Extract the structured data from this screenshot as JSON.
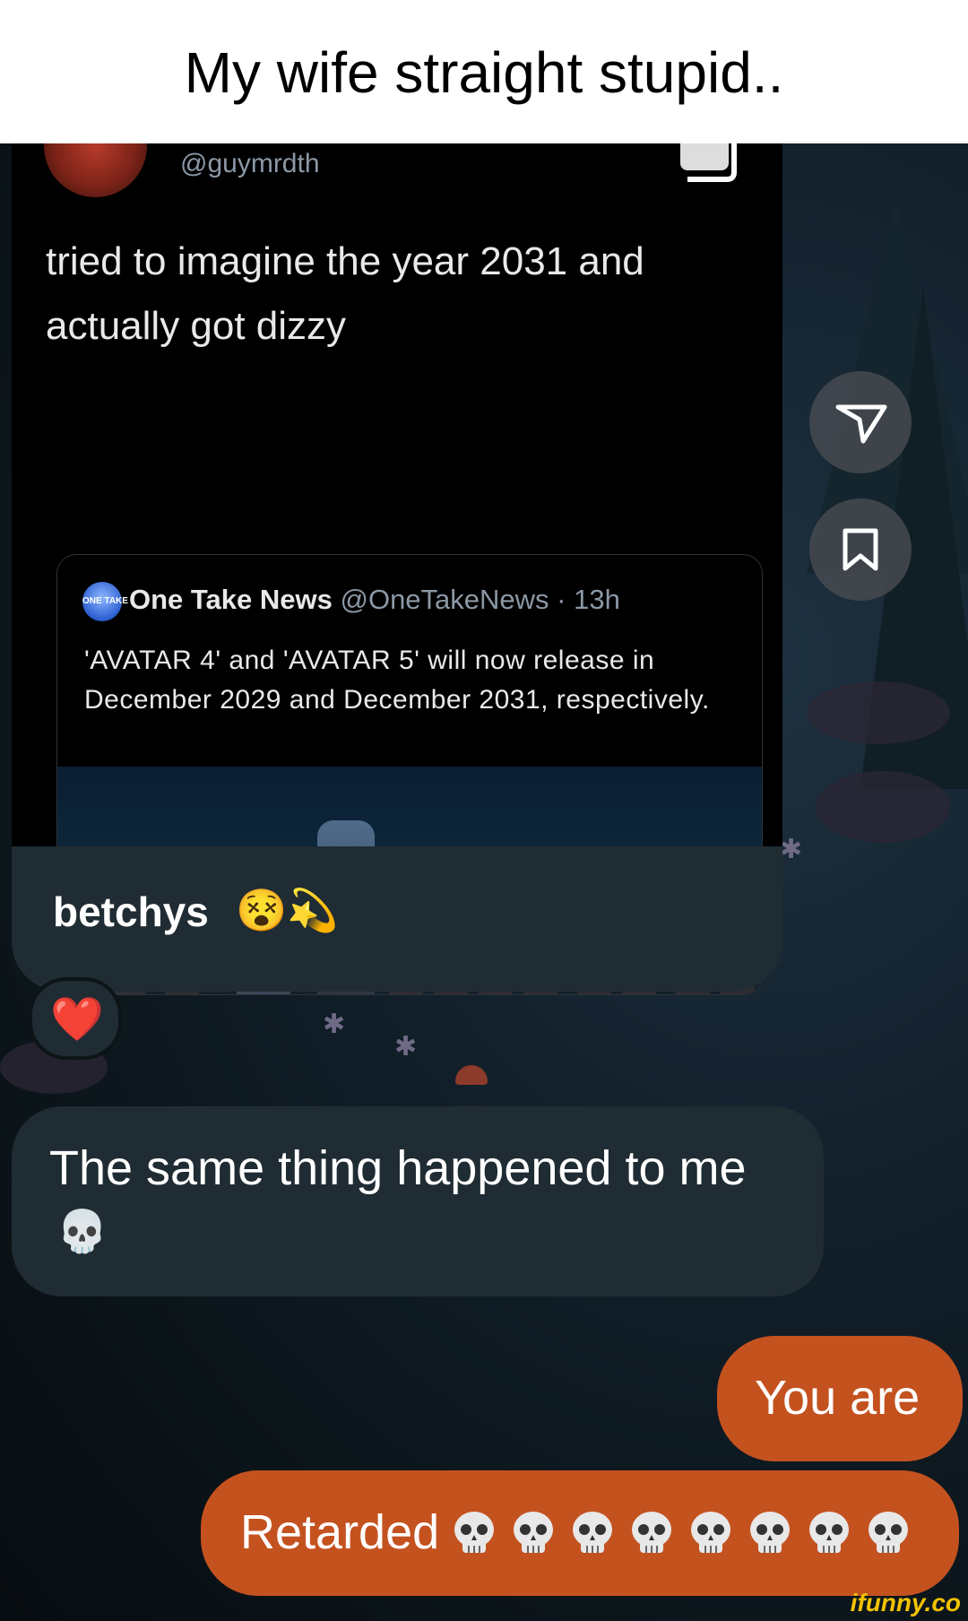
{
  "caption": "My wife straight stupid..",
  "tweet": {
    "handle": "@guymrdth",
    "text": "tried to imagine the year 2031 and actually got dizzy",
    "quote": {
      "logo_text": "ONE TAKE",
      "name": "One Take News",
      "meta": "@OneTakeNews · 13h",
      "text": "'AVATAR 4' and 'AVATAR 5' will now release in December 2029 and December 2031, respectively."
    }
  },
  "side_actions": {
    "share_icon": "paper-plane-icon",
    "save_icon": "bookmark-icon"
  },
  "messages": [
    {
      "from": "them",
      "text": "betchys",
      "emoji": "😵💫"
    },
    {
      "from": "them",
      "reaction": "❤️"
    },
    {
      "from": "them",
      "text": "The same thing happened to me",
      "emoji": "💀"
    },
    {
      "from": "me",
      "text": "You are"
    },
    {
      "from": "me",
      "text": "Retarded",
      "skull_count": 8
    }
  ],
  "watermark": "ifunny.co",
  "colors": {
    "incoming_bubble": "#202c33",
    "outgoing_bubble": "#c4521f",
    "tweet_bg": "#000000"
  }
}
